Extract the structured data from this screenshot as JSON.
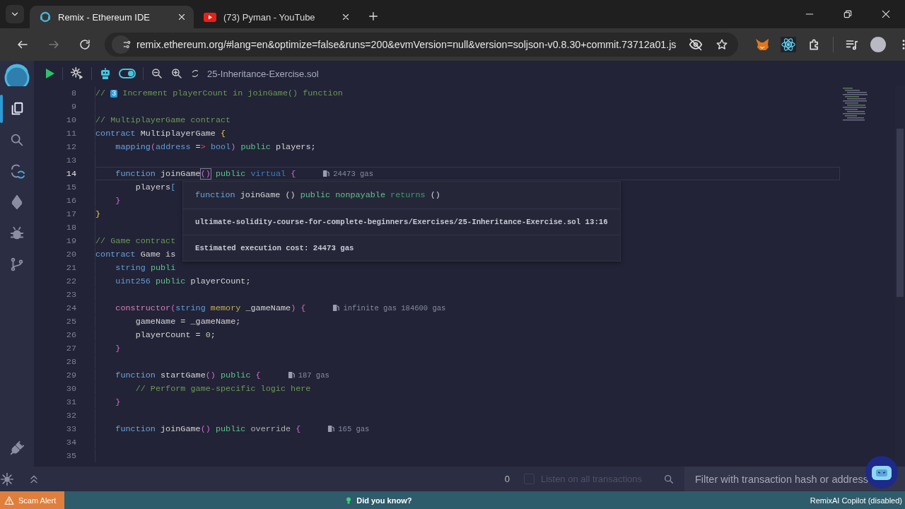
{
  "browser": {
    "tabs": [
      {
        "title": "Remix - Ethereum IDE",
        "selected": true,
        "kind": "remix"
      },
      {
        "title": "(73) Pyman - YouTube",
        "selected": false,
        "kind": "video"
      }
    ],
    "url": "remix.ethereum.org/#lang=en&optimize=false&runs=200&evmVersion=null&version=soljson-v0.8.30+commit.73712a01.js"
  },
  "toolbar": {
    "ai_toggle": {
      "on": true
    },
    "file_name": "25-Inheritance-Exercise.sol"
  },
  "sidebar": {
    "items": [
      {
        "kind": "files",
        "selected": true
      },
      {
        "kind": "search",
        "selected": false
      },
      {
        "kind": "compiler",
        "selected": false
      },
      {
        "kind": "deploy",
        "selected": false
      },
      {
        "kind": "debugger",
        "selected": false
      },
      {
        "kind": "git",
        "selected": false
      }
    ],
    "bottom": [
      {
        "kind": "plugins",
        "selected": false
      }
    ]
  },
  "editor": {
    "lines": [
      {
        "number": "8",
        "current": false,
        "tokens": [
          {
            "text": "// ",
            "kind": "comment"
          },
          {
            "text": "3",
            "kind": "keycap"
          },
          {
            "text": " Increment playerCount in joinGame() function",
            "kind": "comment"
          }
        ]
      },
      {
        "number": "9",
        "current": false
      },
      {
        "number": "10",
        "current": false,
        "tokens": [
          {
            "text": "// MultiplayerGame contract",
            "kind": "comment"
          }
        ]
      },
      {
        "number": "11",
        "current": false,
        "tokens": [
          {
            "text": "contract",
            "kind": "kw"
          },
          {
            "text": " MultiplayerGame ",
            "kind": "name"
          },
          {
            "text": "{",
            "kind": "brace1"
          }
        ]
      },
      {
        "number": "12",
        "current": false,
        "tokens": [
          {
            "text": "    mapping",
            "kind": "kw"
          },
          {
            "text": "(",
            "kind": "paren"
          },
          {
            "text": "address",
            "kind": "type"
          },
          {
            "text": " =",
            "kind": "name"
          },
          {
            "text": ">",
            "kind": "err"
          },
          {
            "text": " bool",
            "kind": "type"
          },
          {
            "text": ")",
            "kind": "paren"
          },
          {
            "text": " public",
            "kind": "vis"
          },
          {
            "text": " players;",
            "kind": "name"
          }
        ]
      },
      {
        "number": "13",
        "current": false
      },
      {
        "number": "14",
        "current": true,
        "tokens": [
          {
            "text": "    function",
            "kind": "kw"
          },
          {
            "text": " joinGame",
            "kind": "name"
          },
          {
            "text": "()",
            "kind": "match"
          },
          {
            "text": " public",
            "kind": "vis"
          },
          {
            "text": " virtual",
            "kind": "mod"
          },
          {
            "text": " {",
            "kind": "brace2"
          }
        ],
        "hint": "24473 gas"
      },
      {
        "number": "15",
        "current": false,
        "tokens": [
          {
            "text": "        players",
            "kind": "name"
          },
          {
            "text": "[",
            "kind": "bracket"
          }
        ]
      },
      {
        "number": "16",
        "current": false,
        "tokens": [
          {
            "text": "    }",
            "kind": "brace2"
          }
        ]
      },
      {
        "number": "17",
        "current": false,
        "tokens": [
          {
            "text": "}",
            "kind": "brace1"
          }
        ]
      },
      {
        "number": "18",
        "current": false
      },
      {
        "number": "19",
        "current": false,
        "tokens": [
          {
            "text": "// Game contract",
            "kind": "comment"
          }
        ]
      },
      {
        "number": "20",
        "current": false,
        "tokens": [
          {
            "text": "contract",
            "kind": "kw"
          },
          {
            "text": " Game is",
            "kind": "name"
          }
        ]
      },
      {
        "number": "21",
        "current": false,
        "tokens": [
          {
            "text": "    string",
            "kind": "type"
          },
          {
            "text": " publi",
            "kind": "vis"
          }
        ]
      },
      {
        "number": "22",
        "current": false,
        "tokens": [
          {
            "text": "    uint256",
            "kind": "type"
          },
          {
            "text": " public",
            "kind": "vis"
          },
          {
            "text": " playerCount;",
            "kind": "name"
          }
        ]
      },
      {
        "number": "23",
        "current": false
      },
      {
        "number": "24",
        "current": false,
        "tokens": [
          {
            "text": "    constructor",
            "kind": "ctor"
          },
          {
            "text": "(",
            "kind": "paren"
          },
          {
            "text": "string",
            "kind": "type"
          },
          {
            "text": " memory",
            "kind": "mem"
          },
          {
            "text": " _gameName",
            "kind": "name"
          },
          {
            "text": ")",
            "kind": "paren"
          },
          {
            "text": " {",
            "kind": "brace2"
          }
        ],
        "hint": "infinite gas 184600 gas"
      },
      {
        "number": "25",
        "current": false,
        "tokens": [
          {
            "text": "        gameName = _gameName;",
            "kind": "name"
          }
        ]
      },
      {
        "number": "26",
        "current": false,
        "tokens": [
          {
            "text": "        playerCount = ",
            "kind": "name"
          },
          {
            "text": "0",
            "kind": "num"
          },
          {
            "text": ";",
            "kind": "name"
          }
        ]
      },
      {
        "number": "27",
        "current": false,
        "tokens": [
          {
            "text": "    }",
            "kind": "brace2"
          }
        ]
      },
      {
        "number": "28",
        "current": false
      },
      {
        "number": "29",
        "current": false,
        "tokens": [
          {
            "text": "    function",
            "kind": "kw"
          },
          {
            "text": " startGame",
            "kind": "name"
          },
          {
            "text": "()",
            "kind": "paren"
          },
          {
            "text": " public",
            "kind": "vis"
          },
          {
            "text": " {",
            "kind": "brace2"
          }
        ],
        "hint": "187 gas"
      },
      {
        "number": "30",
        "current": false,
        "tokens": [
          {
            "text": "        // Perform game-specific logic here",
            "kind": "comment"
          }
        ]
      },
      {
        "number": "31",
        "current": false,
        "tokens": [
          {
            "text": "    }",
            "kind": "brace2"
          }
        ]
      },
      {
        "number": "32",
        "current": false
      },
      {
        "number": "33",
        "current": false,
        "tokens": [
          {
            "text": "    function",
            "kind": "kw"
          },
          {
            "text": " joinGame",
            "kind": "name"
          },
          {
            "text": "()",
            "kind": "paren"
          },
          {
            "text": " public",
            "kind": "vis"
          },
          {
            "text": " override",
            "kind": "plain"
          },
          {
            "text": " {",
            "kind": "brace2"
          }
        ],
        "hint": "165 gas"
      },
      {
        "number": "34",
        "current": false
      },
      {
        "number": "35",
        "current": false
      }
    ],
    "tooltip": {
      "signature": [
        {
          "text": "function",
          "kind": "kw"
        },
        {
          "text": " joinGame ()",
          "kind": "name"
        },
        {
          "text": " public nonpayable",
          "kind": "vis"
        },
        {
          "text": " returns",
          "kind": "ret"
        },
        {
          "text": " ()",
          "kind": "name"
        }
      ],
      "path": "ultimate-solidity-course-for-complete-beginners/Exercises/25-Inheritance-Exercise.sol 13:16",
      "cost": "Estimated execution cost: 24473 gas"
    }
  },
  "terminal": {
    "count": "0",
    "listen": {
      "label": "Listen on all transactions",
      "checked": false,
      "disabled": true
    },
    "filter_placeholder": "Filter with transaction hash or address"
  },
  "status_bar": {
    "alert": "Scam Alert",
    "tip": "Did you know?",
    "copilot": "RemixAI Copilot (disabled)"
  }
}
